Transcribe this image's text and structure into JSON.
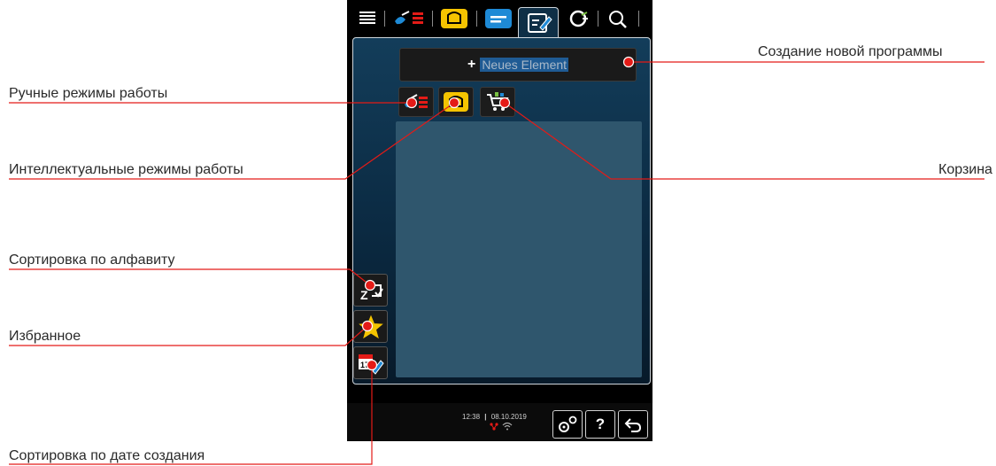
{
  "annotations": {
    "new_program": "Создание новой программы",
    "manual_modes": "Ручные режимы работы",
    "intelligent_modes": "Интеллектуальные режимы работы",
    "basket": "Корзина",
    "sort_alpha": "Сортировка по алфавиту",
    "favorites": "Избранное",
    "sort_date": "Сортировка по дате создания"
  },
  "device": {
    "tabs": [
      "menu-icon",
      "manual-cooking-icon",
      "intelligent-cooking-icon",
      "programs-icon",
      "programming-edit-icon",
      "cleaning-icon",
      "search-icon"
    ],
    "new_element_plus": "+",
    "new_element_label": "Neues Element",
    "mode_buttons": [
      "manual-cooking-icon",
      "intelligent-cooking-icon",
      "basket-icon"
    ],
    "side_buttons": [
      "sort-alphabetical-icon",
      "favorites-star-icon",
      "sort-date-icon"
    ],
    "calendar_day": "17",
    "sort_letter": "Z",
    "status": {
      "time": "12:38",
      "separator": "|",
      "date": "08.10.2019"
    },
    "bottom_buttons": {
      "settings": "settings-gears-icon",
      "help": "?",
      "back": "back-arrow-icon"
    }
  },
  "colors": {
    "accent_red": "#e41b17",
    "screen_blue": "#133d5a",
    "list_area": "#2f566d",
    "yellow": "#f5c400"
  }
}
